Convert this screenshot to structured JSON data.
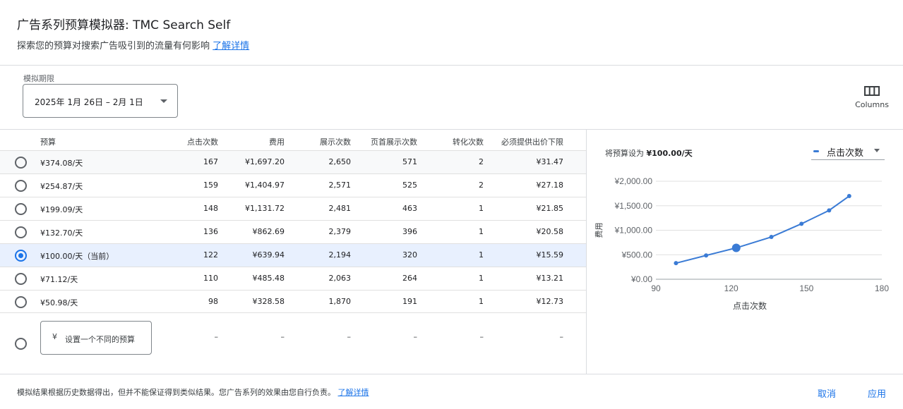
{
  "header": {
    "title": "广告系列预算模拟器: TMC Search Self",
    "subtitle": "探索您的预算对搜索广告吸引到的流量有何影响",
    "learn_more": "了解详情"
  },
  "date_range": {
    "label": "模拟期限",
    "value": "2025年 1月 26日 – 2月 1日"
  },
  "columns_button": {
    "label": "Columns",
    "icon": "columns-icon"
  },
  "table": {
    "headers": [
      "预算",
      "点击次数",
      "费用",
      "展示次数",
      "页首展示次数",
      "转化次数",
      "必须提供出价下限"
    ],
    "rows": [
      {
        "budget": "¥374.08/天",
        "clicks": "167",
        "cost": "¥1,697.20",
        "impressions": "2,650",
        "top_impressions": "571",
        "conversions": "2",
        "min_bid": "¥31.47"
      },
      {
        "budget": "¥254.87/天",
        "clicks": "159",
        "cost": "¥1,404.97",
        "impressions": "2,571",
        "top_impressions": "525",
        "conversions": "2",
        "min_bid": "¥27.18"
      },
      {
        "budget": "¥199.09/天",
        "clicks": "148",
        "cost": "¥1,131.72",
        "impressions": "2,481",
        "top_impressions": "463",
        "conversions": "1",
        "min_bid": "¥21.85"
      },
      {
        "budget": "¥132.70/天",
        "clicks": "136",
        "cost": "¥862.69",
        "impressions": "2,379",
        "top_impressions": "396",
        "conversions": "1",
        "min_bid": "¥20.58"
      },
      {
        "budget": "¥100.00/天（当前）",
        "clicks": "122",
        "cost": "¥639.94",
        "impressions": "2,194",
        "top_impressions": "320",
        "conversions": "1",
        "min_bid": "¥15.59"
      },
      {
        "budget": "¥71.12/天",
        "clicks": "110",
        "cost": "¥485.48",
        "impressions": "2,063",
        "top_impressions": "264",
        "conversions": "1",
        "min_bid": "¥13.21"
      },
      {
        "budget": "¥50.98/天",
        "clicks": "98",
        "cost": "¥328.58",
        "impressions": "1,870",
        "top_impressions": "191",
        "conversions": "1",
        "min_bid": "¥12.73"
      }
    ],
    "selected_index": 4,
    "custom": {
      "currency": "¥",
      "placeholder": "设置一个不同的预算",
      "dash": "–"
    }
  },
  "chart_panel": {
    "heading_prefix": "将预算设为",
    "heading_value": "¥100.00/天",
    "metric_select": "点击次数"
  },
  "chart_data": {
    "type": "line",
    "xlabel": "点击次数",
    "ylabel": "费用",
    "xlim": [
      90,
      180
    ],
    "ylim": [
      0,
      2000
    ],
    "x_ticks": [
      "90",
      "120",
      "150",
      "180"
    ],
    "y_ticks": [
      "¥0.00",
      "¥500.00",
      "¥1,000.00",
      "¥1,500.00",
      "¥2,000.00"
    ],
    "series": [
      {
        "x": [
          98,
          110,
          122,
          136,
          148,
          159,
          167
        ],
        "y": [
          328.58,
          485.48,
          639.94,
          862.69,
          1131.72,
          1404.97,
          1697.2
        ],
        "highlight_index": 2,
        "color": "#3a7bd5"
      }
    ],
    "grid": true
  },
  "footer": {
    "disclaimer": "模拟结果根据历史数据得出，但并不能保证得到类似结果。您广告系列的效果由您自行负责。",
    "learn_more": "了解详情",
    "cancel": "取消",
    "apply": "应用"
  }
}
